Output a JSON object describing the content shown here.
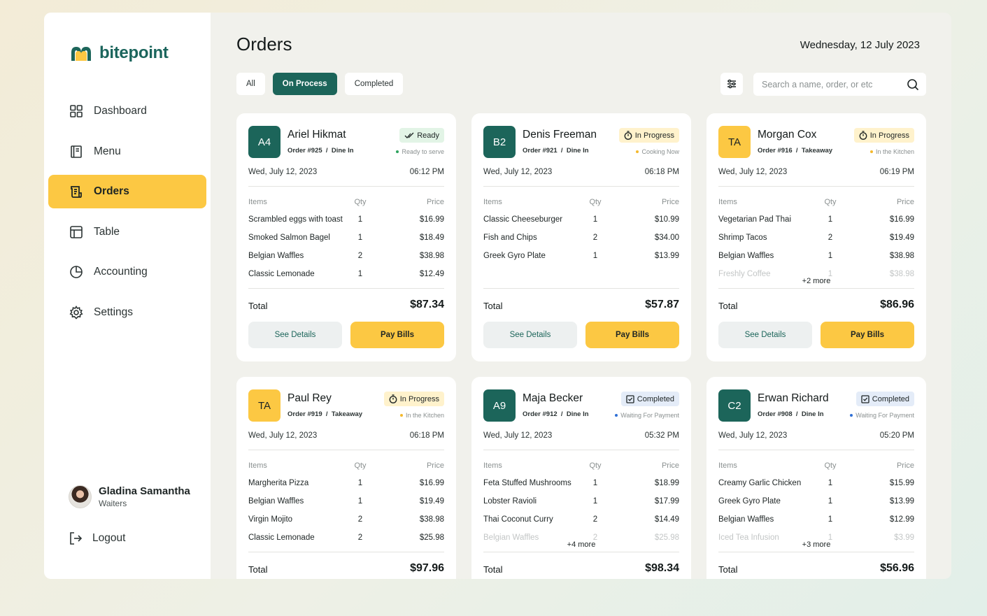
{
  "app": {
    "name": "bitepoint"
  },
  "sidebar": {
    "items": [
      {
        "label": "Dashboard",
        "icon": "dashboard-grid-icon",
        "active": false
      },
      {
        "label": "Menu",
        "icon": "menu-book-icon",
        "active": false
      },
      {
        "label": "Orders",
        "icon": "orders-receipt-icon",
        "active": true
      },
      {
        "label": "Table",
        "icon": "table-icon",
        "active": false
      },
      {
        "label": "Accounting",
        "icon": "pie-chart-icon",
        "active": false
      },
      {
        "label": "Settings",
        "icon": "gear-icon",
        "active": false
      }
    ],
    "profile": {
      "name": "Gladina Samantha",
      "role": "Waiters"
    },
    "logout_label": "Logout"
  },
  "header": {
    "title": "Orders",
    "date": "Wednesday, 12 July 2023"
  },
  "tabs": [
    {
      "label": "All",
      "active": false
    },
    {
      "label": "On Process",
      "active": true
    },
    {
      "label": "Completed",
      "active": false
    }
  ],
  "search": {
    "placeholder": "Search a name, order, or etc"
  },
  "labels": {
    "items": "Items",
    "qty": "Qty",
    "price": "Price",
    "total": "Total",
    "see_details": "See Details",
    "pay_bills": "Pay Bills"
  },
  "colors": {
    "brand": "#1c655a",
    "accent": "#fcc843",
    "ready": "#2fa35f",
    "progress": "#f4b92e",
    "completed": "#2f6fd6"
  },
  "orders": [
    {
      "code": "A4",
      "code_style": "teal",
      "name": "Ariel Hikmat",
      "order_no": "Order #925",
      "type": "Dine In",
      "status": "Ready",
      "status_kind": "ready",
      "substatus": "Ready to serve",
      "date": "Wed, July 12, 2023",
      "time": "06:12 PM",
      "items": [
        {
          "name": "Scrambled eggs with toast",
          "qty": "1",
          "price": "$16.99"
        },
        {
          "name": "Smoked Salmon Bagel",
          "qty": "1",
          "price": "$18.49"
        },
        {
          "name": "Belgian Waffles",
          "qty": "2",
          "price": "$38.98"
        },
        {
          "name": "Classic Lemonade",
          "qty": "1",
          "price": "$12.49"
        }
      ],
      "more": "",
      "total": "$87.34"
    },
    {
      "code": "B2",
      "code_style": "teal",
      "name": "Denis Freeman",
      "order_no": "Order #921",
      "type": "Dine In",
      "status": "In Progress",
      "status_kind": "progress",
      "substatus": "Cooking Now",
      "date": "Wed, July 12, 2023",
      "time": "06:18 PM",
      "items": [
        {
          "name": "Classic Cheeseburger",
          "qty": "1",
          "price": "$10.99"
        },
        {
          "name": "Fish and Chips",
          "qty": "2",
          "price": "$34.00"
        },
        {
          "name": "Greek Gyro Plate",
          "qty": "1",
          "price": "$13.99"
        }
      ],
      "more": "",
      "total": "$57.87"
    },
    {
      "code": "TA",
      "code_style": "yellow",
      "name": "Morgan Cox",
      "order_no": "Order #916",
      "type": "Takeaway",
      "status": "In Progress",
      "status_kind": "progress",
      "substatus": "In the Kitchen",
      "date": "Wed, July 12, 2023",
      "time": "06:19 PM",
      "items": [
        {
          "name": "Vegetarian Pad Thai",
          "qty": "1",
          "price": "$16.99"
        },
        {
          "name": "Shrimp Tacos",
          "qty": "2",
          "price": "$19.49"
        },
        {
          "name": "Belgian Waffles",
          "qty": "1",
          "price": "$38.98"
        },
        {
          "name": "Freshly Coffee",
          "qty": "1",
          "price": "$38.98"
        }
      ],
      "more": "+2 more",
      "total": "$86.96"
    },
    {
      "code": "TA",
      "code_style": "yellow",
      "name": "Paul Rey",
      "order_no": "Order #919",
      "type": "Takeaway",
      "status": "In Progress",
      "status_kind": "progress",
      "substatus": "In the Kitchen",
      "date": "Wed, July 12, 2023",
      "time": "06:18 PM",
      "items": [
        {
          "name": "Margherita Pizza",
          "qty": "1",
          "price": "$16.99"
        },
        {
          "name": "Belgian Waffles",
          "qty": "1",
          "price": "$19.49"
        },
        {
          "name": "Virgin Mojito",
          "qty": "2",
          "price": "$38.98"
        },
        {
          "name": "Classic Lemonade",
          "qty": "2",
          "price": "$25.98"
        }
      ],
      "more": "",
      "total": "$97.96"
    },
    {
      "code": "A9",
      "code_style": "teal",
      "name": "Maja Becker",
      "order_no": "Order #912",
      "type": "Dine In",
      "status": "Completed",
      "status_kind": "completed",
      "substatus": "Waiting For Payment",
      "date": "Wed, July 12, 2023",
      "time": "05:32 PM",
      "items": [
        {
          "name": "Feta Stuffed Mushrooms",
          "qty": "1",
          "price": "$18.99"
        },
        {
          "name": "Lobster Ravioli",
          "qty": "1",
          "price": "$17.99"
        },
        {
          "name": "Thai Coconut Curry",
          "qty": "2",
          "price": "$14.49"
        },
        {
          "name": "Belgian Waffles",
          "qty": "2",
          "price": "$25.98"
        }
      ],
      "more": "+4 more",
      "total": "$98.34"
    },
    {
      "code": "C2",
      "code_style": "teal",
      "name": "Erwan Richard",
      "order_no": "Order #908",
      "type": "Dine In",
      "status": "Completed",
      "status_kind": "completed",
      "substatus": "Waiting For Payment",
      "date": "Wed, July 12, 2023",
      "time": "05:20 PM",
      "items": [
        {
          "name": "Creamy Garlic Chicken",
          "qty": "1",
          "price": "$15.99"
        },
        {
          "name": "Greek Gyro Plate",
          "qty": "1",
          "price": "$13.99"
        },
        {
          "name": "Belgian Waffles",
          "qty": "1",
          "price": "$12.99"
        },
        {
          "name": "Iced Tea Infusion",
          "qty": "1",
          "price": "$3.99"
        }
      ],
      "more": "+3 more",
      "total": "$56.96"
    }
  ]
}
